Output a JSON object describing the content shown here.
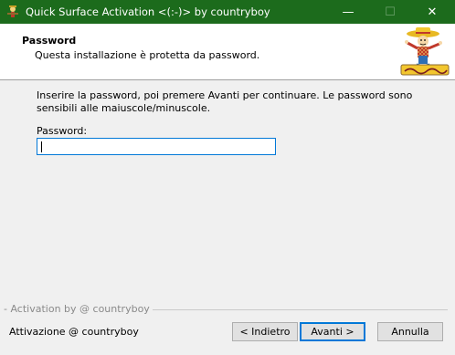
{
  "window": {
    "title": "Quick Surface Activation <(:-)> by countryboy",
    "minimize_glyph": "—",
    "maximize_glyph": "☐",
    "close_glyph": "✕"
  },
  "header": {
    "title": "Password",
    "subtitle": "Questa installazione è protetta da password."
  },
  "content": {
    "intro": "Inserire la password, poi premere Avanti per continuare. Le password sono sensibili alle maiuscole/minuscole.",
    "password_label": "Password:",
    "password_value": ""
  },
  "footer": {
    "brand": "- Activation by @ countryboy",
    "status": "Attivazione @ countryboy",
    "back_label": "< Indietro",
    "next_label": "Avanti >",
    "cancel_label": "Annulla"
  },
  "colors": {
    "titlebar": "#1c6b1c",
    "accent": "#0078d7"
  },
  "icons": {
    "app": "scarecrow-icon",
    "logo": "countryboy-logo"
  }
}
